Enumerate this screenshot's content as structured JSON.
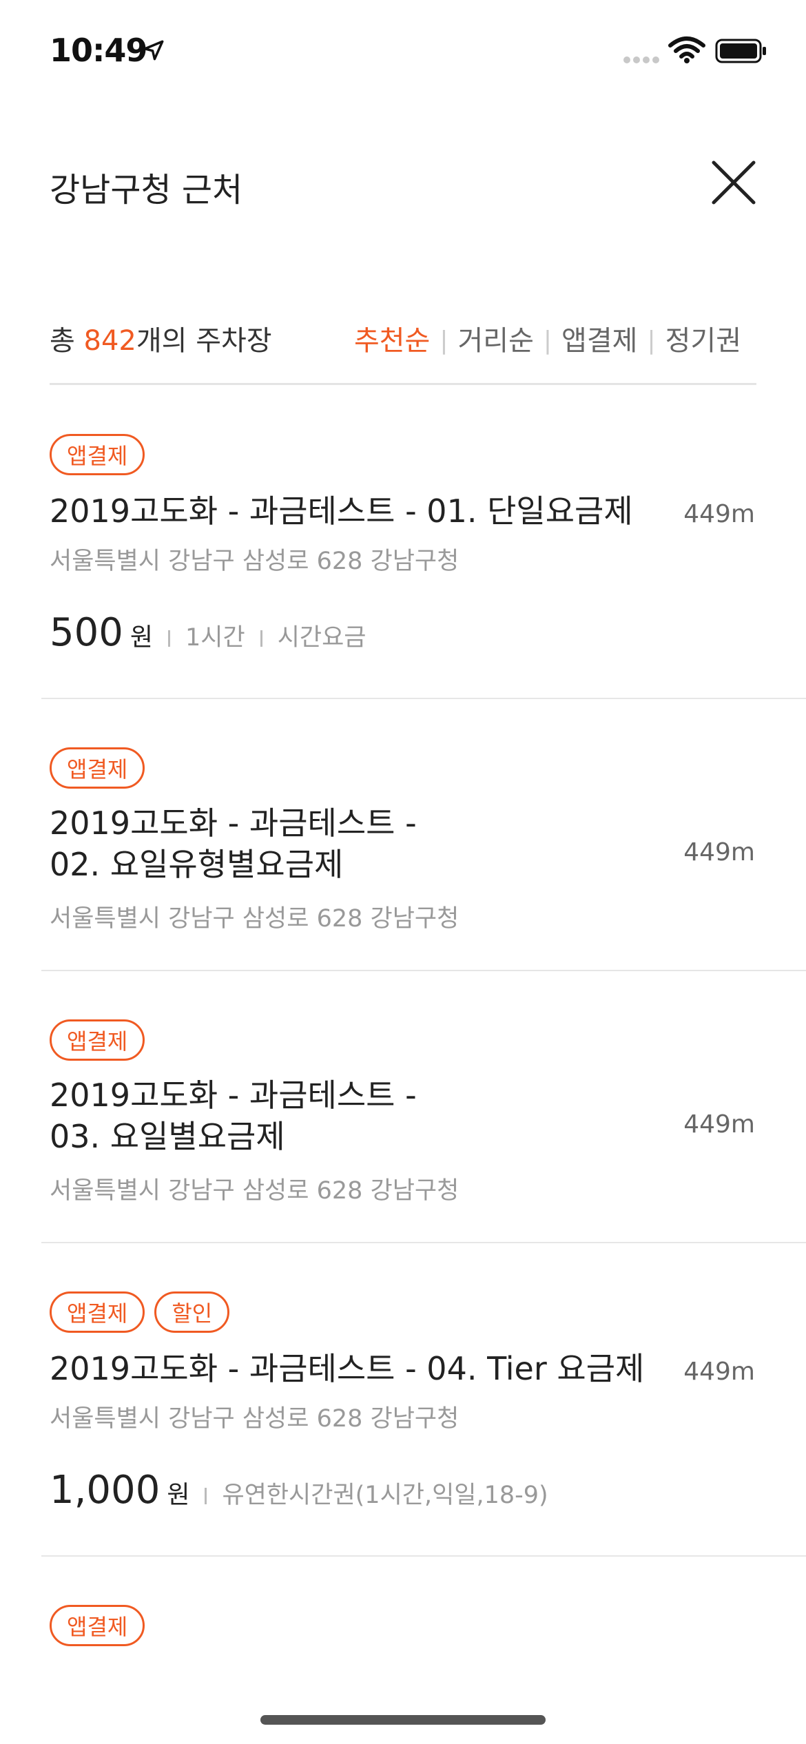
{
  "status_bar": {
    "time": "10:49"
  },
  "header": {
    "title": "강남구청 근처"
  },
  "summary": {
    "prefix": "총 ",
    "count": "842",
    "suffix": "개의 주차장"
  },
  "sort_tabs": [
    {
      "label": "추천순",
      "active": true
    },
    {
      "label": "거리순",
      "active": false
    },
    {
      "label": "앱결제",
      "active": false
    },
    {
      "label": "정기권",
      "active": false
    }
  ],
  "items": [
    {
      "badges": [
        "앱결제"
      ],
      "title": "2019고도화 - 과금테스트 - 01. 단일요금제",
      "distance": "449m",
      "address": "서울특별시 강남구 삼성로 628 강남구청",
      "price": {
        "amount": "500",
        "unit": "원",
        "details": [
          "1시간",
          "시간요금"
        ]
      }
    },
    {
      "badges": [
        "앱결제"
      ],
      "title_line1": "2019고도화 - 과금테스트 -",
      "title_line2": "02. 요일유형별요금제",
      "distance": "449m",
      "address": "서울특별시 강남구 삼성로 628 강남구청"
    },
    {
      "badges": [
        "앱결제"
      ],
      "title_line1": "2019고도화 - 과금테스트 -",
      "title_line2": "03. 요일별요금제",
      "distance": "449m",
      "address": "서울특별시 강남구 삼성로 628 강남구청"
    },
    {
      "badges": [
        "앱결제",
        "할인"
      ],
      "title": "2019고도화 - 과금테스트 - 04. Tier 요금제",
      "distance": "449m",
      "address": "서울특별시 강남구 삼성로 628 강남구청",
      "price": {
        "amount": "1,000",
        "unit": "원",
        "details": [
          "유연한시간권(1시간,익일,18-9)"
        ]
      }
    },
    {
      "badges": [
        "앱결제"
      ]
    }
  ],
  "colors": {
    "accent": "#f05a22",
    "text_primary": "#222222",
    "text_secondary": "#999999",
    "divider": "#e6e6e6"
  }
}
